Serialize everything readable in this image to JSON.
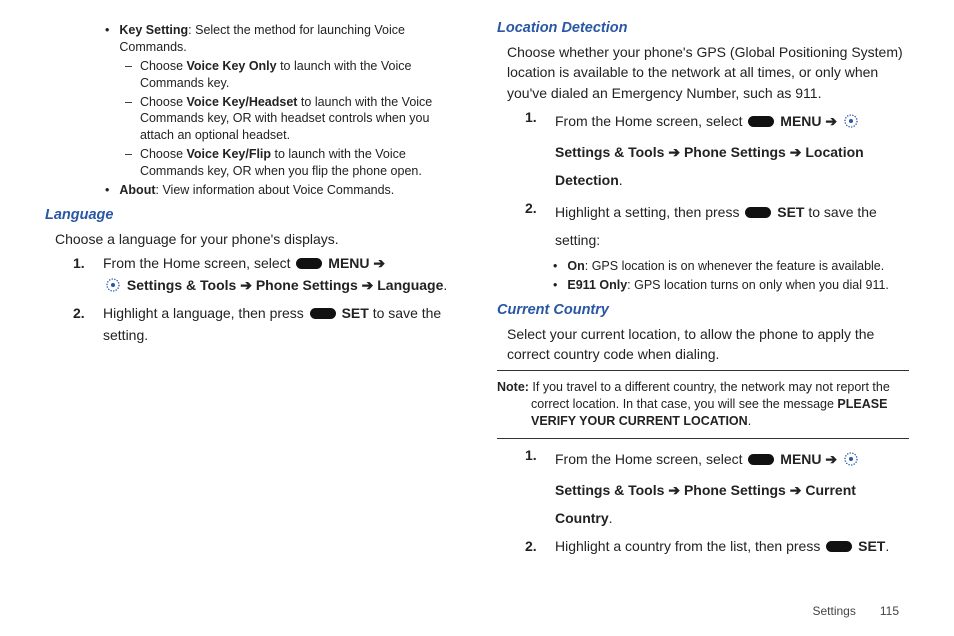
{
  "left": {
    "bullets": [
      {
        "bold": "Key Setting",
        "rest": ": Select the method for launching Voice Commands."
      },
      {
        "bold": "About",
        "rest": ": View information about Voice Commands."
      }
    ],
    "dashes": [
      {
        "pre": "Choose ",
        "bold": "Voice Key Only",
        "rest": " to launch with the Voice Commands key."
      },
      {
        "pre": "Choose ",
        "bold": "Voice Key/Headset",
        "rest": " to launch with the Voice Commands key, OR with headset controls when you attach an optional headset."
      },
      {
        "pre": "Choose ",
        "bold": "Voice Key/Flip",
        "rest": " to launch with the Voice Commands key, OR when you flip the phone open."
      }
    ],
    "language": {
      "heading": "Language",
      "intro": "Choose a language for your phone's displays.",
      "step1_a": "From the Home screen, select ",
      "step1_menu": "MENU",
      "step1_settings": "Settings & Tools",
      "step1_phone": "Phone Settings",
      "step1_last": "Language",
      "step2_a": "Highlight a language, then press ",
      "step2_set": "SET",
      "step2_b": " to save the setting."
    }
  },
  "right": {
    "location": {
      "heading": "Location Detection",
      "intro": "Choose whether your phone's GPS (Global Positioning System) location is available to the network at all times, or only when you've dialed an Emergency Number, such as 911.",
      "step1_a": "From the Home screen, select ",
      "step1_menu": "MENU",
      "step1_settings": "Settings & Tools",
      "step1_phone": "Phone Settings",
      "step1_last": "Location Detection",
      "step2_a": "Highlight a setting, then press ",
      "step2_set": "SET",
      "step2_b": " to save the setting:",
      "opts": [
        {
          "bold": "On",
          "rest": ": GPS location is on whenever the feature is available."
        },
        {
          "bold": "E911 Only",
          "rest": ": GPS location turns on only when you dial 911."
        }
      ]
    },
    "country": {
      "heading": "Current Country",
      "intro": "Select your current location, to allow the phone to apply the correct country code when dialing.",
      "note_bold": "Note:",
      "note_text": " If you travel to a different country, the network may not report the correct location. In that case, you will see the message ",
      "note_upper": "PLEASE VERIFY YOUR CURRENT LOCATION",
      "step1_a": "From the Home screen, select ",
      "step1_menu": "MENU",
      "step1_settings": "Settings & Tools",
      "step1_phone": "Phone Settings",
      "step1_last": "Current Country",
      "step2_a": "Highlight a country from the list, then press ",
      "step2_set": "SET"
    }
  },
  "arrow": "➔",
  "footer": {
    "section": "Settings",
    "page": "115"
  }
}
